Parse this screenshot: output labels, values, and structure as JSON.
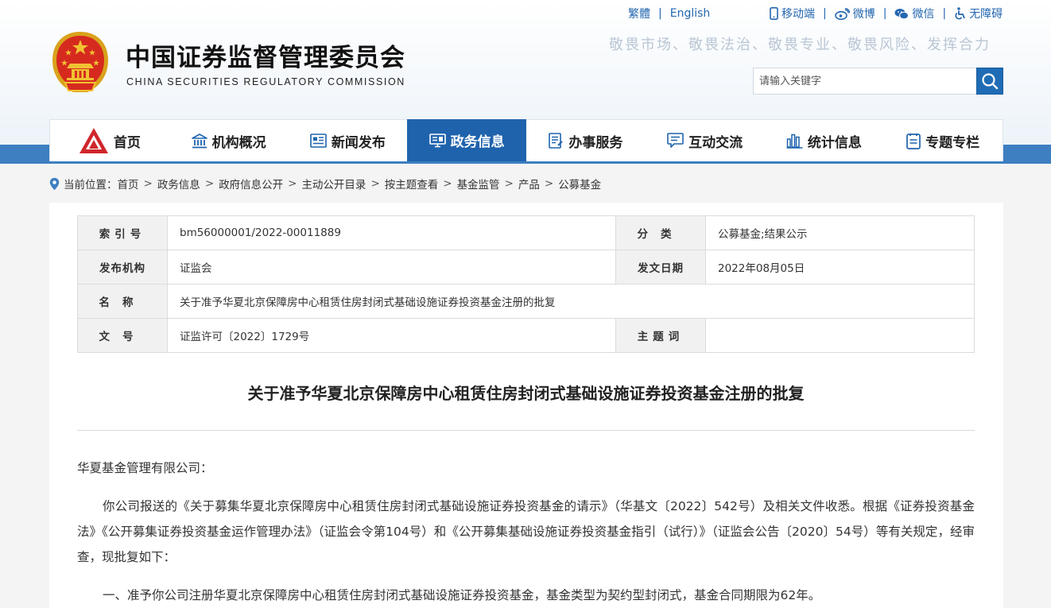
{
  "colors": {
    "primary_blue": "#1f63ad",
    "link_blue": "#2467b0",
    "band_blue": "#3d7fc1",
    "emblem_red": "#d62a1f",
    "emblem_gold": "#f1c232"
  },
  "toplinks": {
    "traditional": "繁體",
    "english": "English",
    "mobile": "移动端",
    "weibo": "微博",
    "wechat": "微信",
    "accessibility": "无障碍"
  },
  "header": {
    "site_name_cn": "中国证券监督管理委员会",
    "site_name_en": "CHINA SECURITIES REGULATORY COMMISSION",
    "slogan": "敬畏市场、敬畏法治、敬畏专业、敬畏风险、发挥合力"
  },
  "search": {
    "placeholder": "请输入关键字",
    "icon": "search-icon"
  },
  "nav": {
    "items": [
      {
        "label": "首页",
        "icon": "home-logo-icon"
      },
      {
        "label": "机构概况",
        "icon": "institution-icon"
      },
      {
        "label": "新闻发布",
        "icon": "news-icon"
      },
      {
        "label": "政务信息",
        "icon": "government-info-icon",
        "active": true
      },
      {
        "label": "办事服务",
        "icon": "service-icon"
      },
      {
        "label": "互动交流",
        "icon": "chat-icon"
      },
      {
        "label": "统计信息",
        "icon": "statistics-icon"
      },
      {
        "label": "专题专栏",
        "icon": "topic-icon"
      }
    ]
  },
  "breadcrumb": {
    "label": "当前位置：",
    "items": [
      "首页",
      "政务信息",
      "政府信息公开",
      "主动公开目录",
      "按主题查看",
      "基金监管",
      "产品",
      "公募基金"
    ]
  },
  "meta": {
    "index_label": "索引号",
    "index_value": "bm56000001/2022-00011889",
    "category_label": "分类",
    "category_value": "公募基金;结果公示",
    "publisher_label": "发布机构",
    "publisher_value": "证监会",
    "date_label": "发文日期",
    "date_value": "2022年08月05日",
    "name_label": "名称",
    "name_value": "关于准予华夏北京保障房中心租赁住房封闭式基础设施证券投资基金注册的批复",
    "docno_label": "文号",
    "docno_value": "证监许可〔2022〕1729号",
    "keywords_label": "主题词",
    "keywords_value": ""
  },
  "document": {
    "title": "关于准予华夏北京保障房中心租赁住房封闭式基础设施证券投资基金注册的批复",
    "addressee": "华夏基金管理有限公司：",
    "paragraph1": "你公司报送的《关于募集华夏北京保障房中心租赁住房封闭式基础设施证券投资基金的请示》（华基文〔2022〕542号）及相关文件收悉。根据《证券投资基金法》《公开募集证券投资基金运作管理办法》（证监会令第104号）和《公开募集基础设施证券投资基金指引（试行）》（证监会公告〔2020〕54号）等有关规定，经审查，现批复如下：",
    "paragraph2": "一、准予你公司注册华夏北京保障房中心租赁住房封闭式基础设施证券投资基金，基金类型为契约型封闭式，基金合同期限为62年。"
  }
}
